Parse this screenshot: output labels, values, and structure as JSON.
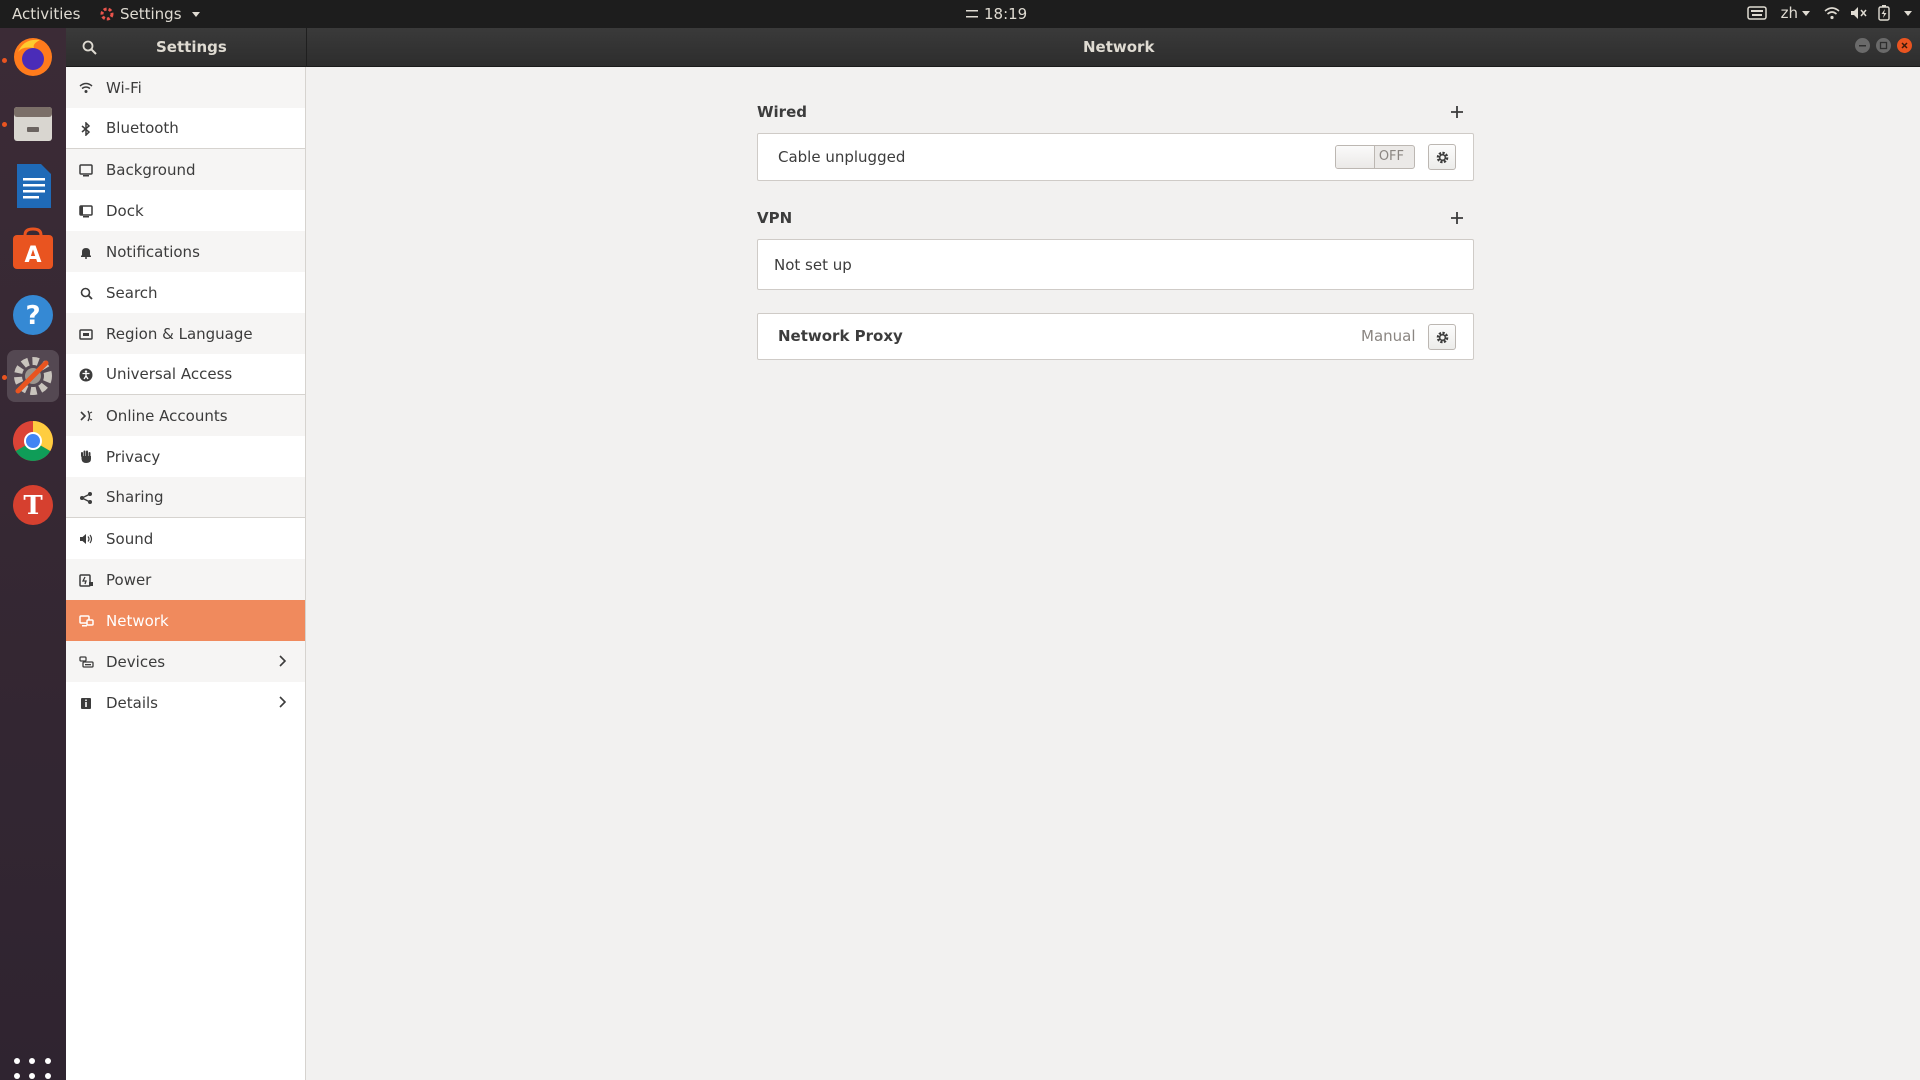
{
  "topbar": {
    "activities": "Activities",
    "app_menu": "Settings",
    "clock": "18:19",
    "input_method": "zh"
  },
  "dock": {
    "items": [
      {
        "name": "firefox-icon"
      },
      {
        "name": "files-icon"
      },
      {
        "name": "writer-icon"
      },
      {
        "name": "software-icon"
      },
      {
        "name": "help-icon"
      },
      {
        "name": "settings-icon"
      },
      {
        "name": "chrome-icon"
      },
      {
        "name": "app-t-icon"
      }
    ]
  },
  "headerbar": {
    "left_title": "Settings",
    "title": "Network"
  },
  "sidebar": {
    "items": [
      {
        "label": "Wi-Fi",
        "icon": "wifi-icon"
      },
      {
        "label": "Bluetooth",
        "icon": "bluetooth-icon"
      },
      {
        "label": "Background",
        "icon": "background-icon"
      },
      {
        "label": "Dock",
        "icon": "dock-icon"
      },
      {
        "label": "Notifications",
        "icon": "bell-icon"
      },
      {
        "label": "Search",
        "icon": "search-icon"
      },
      {
        "label": "Region & Language",
        "icon": "region-icon"
      },
      {
        "label": "Universal Access",
        "icon": "accessibility-icon"
      },
      {
        "label": "Online Accounts",
        "icon": "online-accounts-icon"
      },
      {
        "label": "Privacy",
        "icon": "hand-icon"
      },
      {
        "label": "Sharing",
        "icon": "share-icon"
      },
      {
        "label": "Sound",
        "icon": "speaker-icon"
      },
      {
        "label": "Power",
        "icon": "power-icon"
      },
      {
        "label": "Network",
        "icon": "network-icon"
      },
      {
        "label": "Devices",
        "icon": "devices-icon"
      },
      {
        "label": "Details",
        "icon": "info-icon"
      }
    ],
    "selected": "Network"
  },
  "network": {
    "wired": {
      "title": "Wired",
      "status": "Cable unplugged",
      "switch_label": "OFF"
    },
    "vpn": {
      "title": "VPN",
      "status": "Not set up"
    },
    "proxy": {
      "label": "Network Proxy",
      "value": "Manual"
    }
  },
  "colors": {
    "accent": "#f08a5d",
    "topbar": "#1d1d1d",
    "headerbar": "#2e2e2e",
    "dock": "#3a2a34"
  }
}
